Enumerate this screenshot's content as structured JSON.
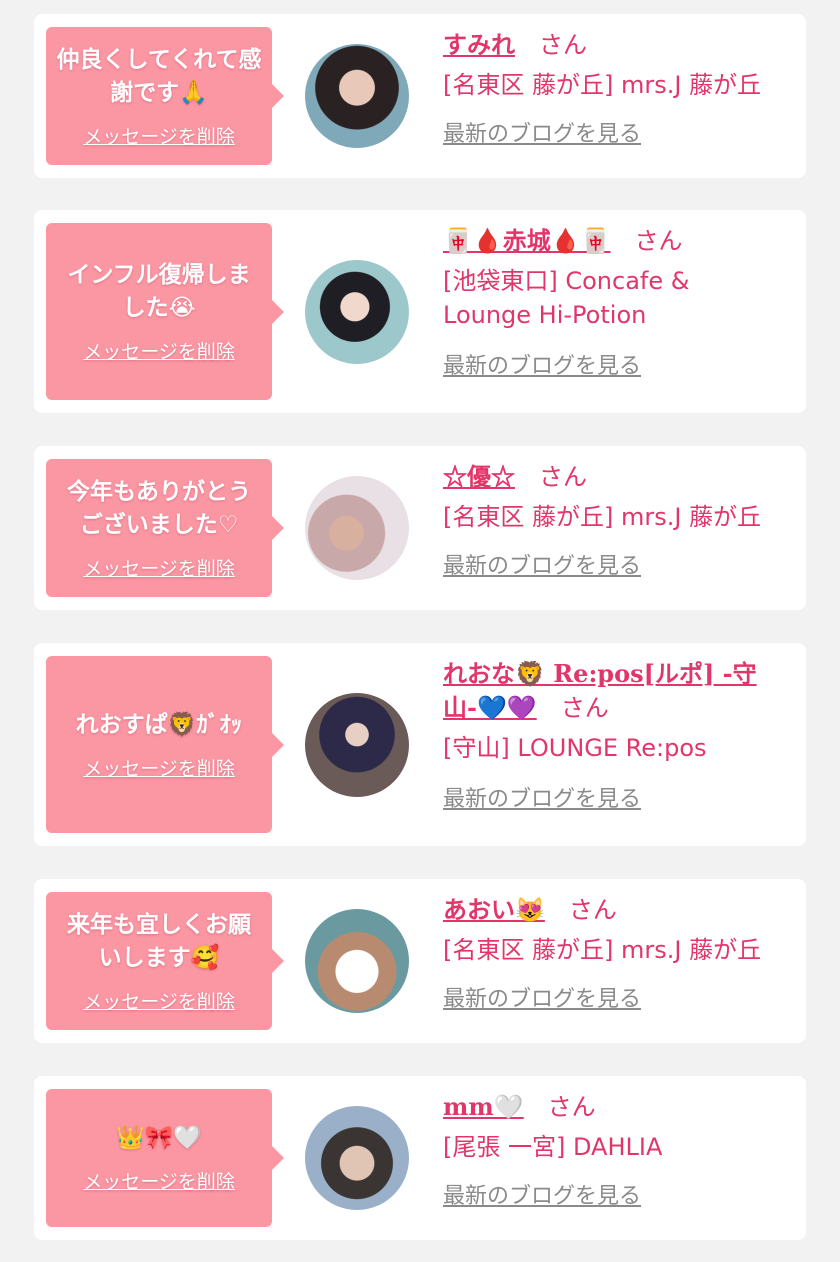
{
  "delete_label": "メッセージを削除",
  "san_label": "さん",
  "blog_label": "最新のブログを見る",
  "colors": {
    "accent": "#e2366b",
    "bubble": "#fb96a3",
    "background": "#f2f2f2",
    "card": "#ffffff",
    "link_gray": "#8a8a8a"
  },
  "messages": [
    {
      "message": "仲良くしてくれて感謝です🙏",
      "name": "すみれ",
      "shop": "[名東区 藤が丘] mrs.J 藤が丘"
    },
    {
      "message": "インフル復帰しました😭",
      "name": "🀄🩸赤城🩸🀄",
      "shop": "[池袋東口] Concafe & Lounge Hi-Potion"
    },
    {
      "message": "今年もありがとうございました♡",
      "name": "☆優☆",
      "shop": "[名東区 藤が丘] mrs.J 藤が丘"
    },
    {
      "message": "れおすぱ🦁ｶﾞｵｯ",
      "name": "れおな🦁 Re:pos[ルポ] -守山-💙💜",
      "shop": "[守山] LOUNGE Re:pos"
    },
    {
      "message": "来年も宜しくお願いします🥰",
      "name": "あおい😻",
      "shop": "[名東区 藤が丘] mrs.J 藤が丘"
    },
    {
      "message": "👑🎀🤍",
      "name": "mm🤍",
      "shop": "[尾張 一宮] DAHLIA"
    }
  ]
}
